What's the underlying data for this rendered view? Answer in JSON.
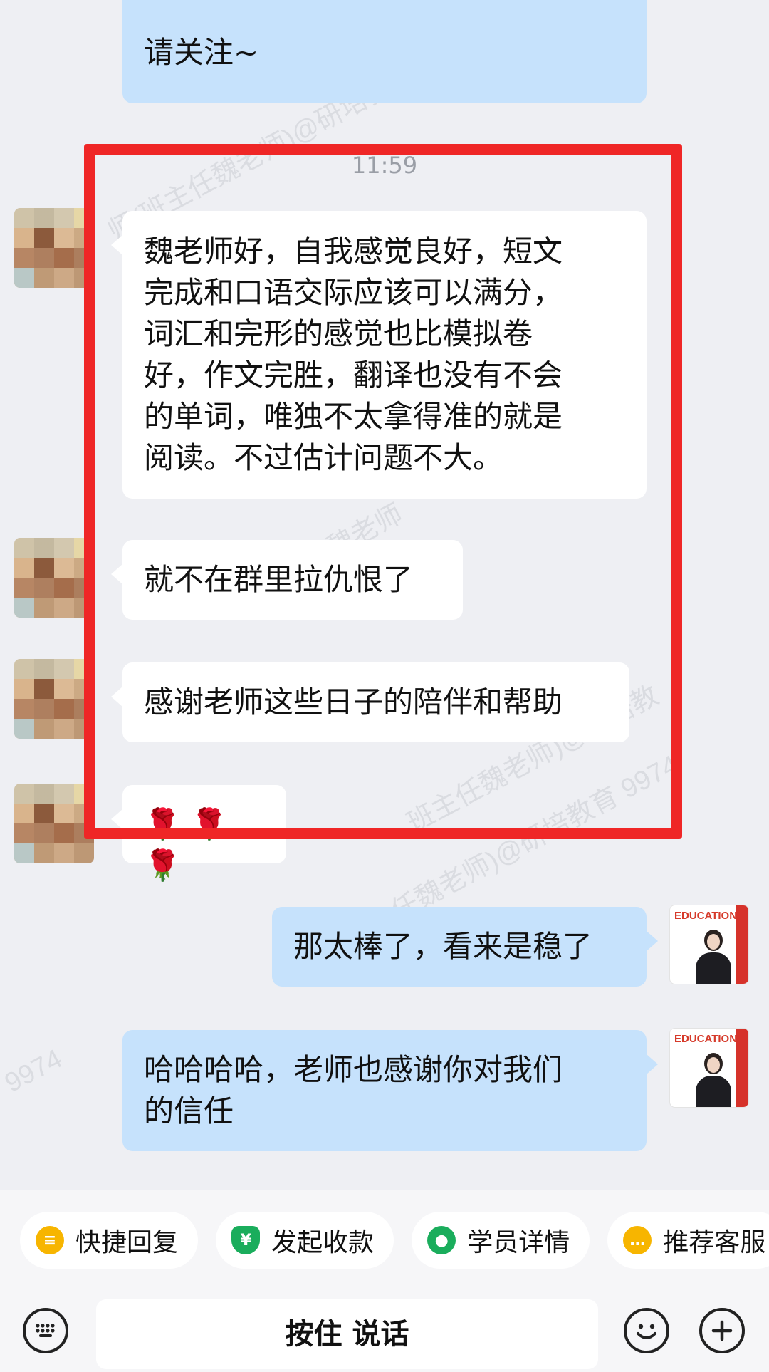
{
  "messages": {
    "m1_text": "请关注~",
    "time": "11:59",
    "m2_lines": [
      "魏老师好，自我感觉良好，短文",
      "完成和口语交际应该可以满分，",
      "词汇和完形的感觉也比模拟卷",
      "好，作文完胜，翻译也没有不会",
      "的单词，唯独不太拿得准的就是",
      "阅读。不过估计问题不大。"
    ],
    "m3_text": "就不在群里拉仇恨了",
    "m4_text": "感谢老师这些日子的陪伴和帮助",
    "m5_text": "🌹 🌹 🌹",
    "m6_text": "那太棒了，看来是稳了",
    "m7_lines": [
      "哈哈哈哈，老师也感谢你对我们",
      "的信任"
    ]
  },
  "avatar": {
    "teacher_logo": "EDUCATION"
  },
  "watermark": {
    "text1": "师(班主任魏老师)@研培教",
    "text2": "主任魏老师",
    "text3": "班主任魏老师)@研培教育 9974",
    "text4": "9974",
    "text5": "班主任魏老师)@研培教"
  },
  "toolbar": {
    "chips": [
      {
        "label": "快捷回复",
        "color": "#f7b500",
        "icon": "message-icon"
      },
      {
        "label": "发起收款",
        "color": "#1aad5c",
        "icon": "yuan-shield-icon"
      },
      {
        "label": "学员详情",
        "color": "#1aad5c",
        "icon": "user-icon"
      },
      {
        "label": "推荐客服",
        "color": "#f7b500",
        "icon": "chat-icon"
      }
    ],
    "hold_to_talk": "按住 说话"
  },
  "colors": {
    "accent_frame": "#ef2626",
    "outgoing_bubble": "#c6e2fc",
    "incoming_bubble": "#ffffff"
  }
}
